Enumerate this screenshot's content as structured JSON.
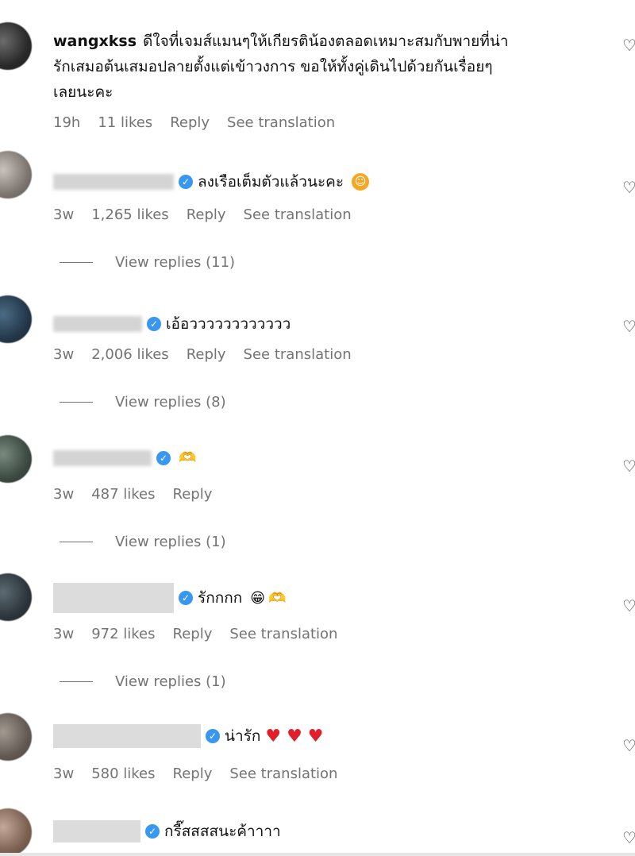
{
  "comments": [
    {
      "username": "wangxkss",
      "text_line1": "ดีใจที่เจมส์แมนๆให้เกียรติน้องตลอดเหมาะสมกับพายที่น่า",
      "text_line2": "รักเสมอต้นเสมอปลายตั้งแต่เข้าวงการ ขอให้ทั้งคู่เดินไปด้วยกันเรื่อยๆ",
      "text_line3": "เลยนะคะ",
      "time": "19h",
      "likes": "11 likes",
      "reply": "Reply",
      "translate": "See translation"
    },
    {
      "username_blurred": "grand_theater",
      "text": "ลงเรือเต็มตัวแล้วนะคะ",
      "emoji": "smiling-face-icon",
      "time": "3w",
      "likes": "1,265 likes",
      "reply": "Reply",
      "translate": "See translation",
      "view_replies": "View replies (11)"
    },
    {
      "username_blurred": "mark_prin",
      "text": "เอ้อวววววววววววว",
      "time": "3w",
      "likes": "2,006 likes",
      "reply": "Reply",
      "translate": "See translation",
      "view_replies": "View replies (8)"
    },
    {
      "username_blurred": "plusrandall",
      "emoji": "heart-hands-icon",
      "time": "3w",
      "likes": "487 likes",
      "reply": "Reply",
      "view_replies": "View replies (1)"
    },
    {
      "text": "รักกกก",
      "emoji": "grinning-face-icon",
      "time": "3w",
      "likes": "972 likes",
      "reply": "Reply",
      "translate": "See translation",
      "view_replies": "View replies (1)"
    },
    {
      "text": "น่ารัก",
      "hearts": "♥ ♥ ♥",
      "time": "3w",
      "likes": "580 likes",
      "reply": "Reply",
      "translate": "See translation"
    },
    {
      "text": "กรี๊สสสสนะค้าาาา"
    }
  ],
  "icons": {
    "like": "heart-outline-icon",
    "verified": "verified-badge-icon",
    "verified_mark": "✓",
    "heart_outline": "♡",
    "smile": "☺",
    "grin": "😁",
    "heart_hands": "🫶"
  },
  "colors": {
    "verified": "#3897f0",
    "meta_text": "#737373",
    "red_heart": "#e0202a"
  }
}
